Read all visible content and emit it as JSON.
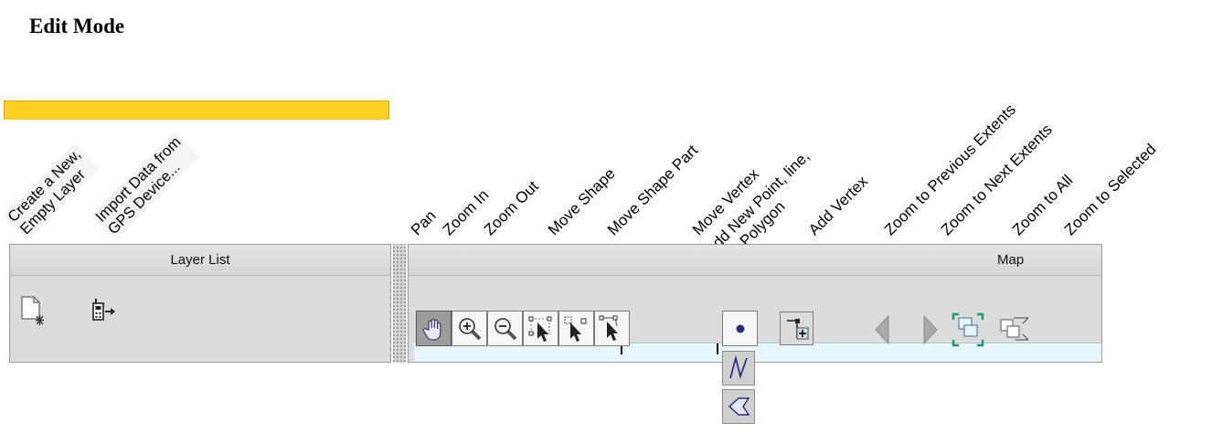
{
  "heading": "Edit Mode",
  "annotations": {
    "create_layer": [
      "Create a New,",
      "Empty Layer"
    ],
    "import_gps": [
      "Import Data from",
      "GPS Device..."
    ],
    "pan": "Pan",
    "zoom_in": "Zoom In",
    "zoom_out": "Zoom Out",
    "move_shape": "Move Shape",
    "move_shape_part": "Move Shape Part",
    "move_vertex": "Move Vertex",
    "add_new": [
      "Add New Point, line,",
      "or Polygon"
    ],
    "add_vertex": "Add Vertex",
    "zoom_prev": "Zoom to Previous Extents",
    "zoom_next": "Zoom to Next Extents",
    "zoom_all": "Zoom to All",
    "zoom_selected": "Zoom to Selected"
  },
  "layer_panel": {
    "title": "Layer List"
  },
  "map_panel": {
    "title": "Map"
  },
  "colors": {
    "selection": "#ffd024",
    "map_background": "#e8f7fc",
    "pressed_button": "#9c9c9c"
  }
}
